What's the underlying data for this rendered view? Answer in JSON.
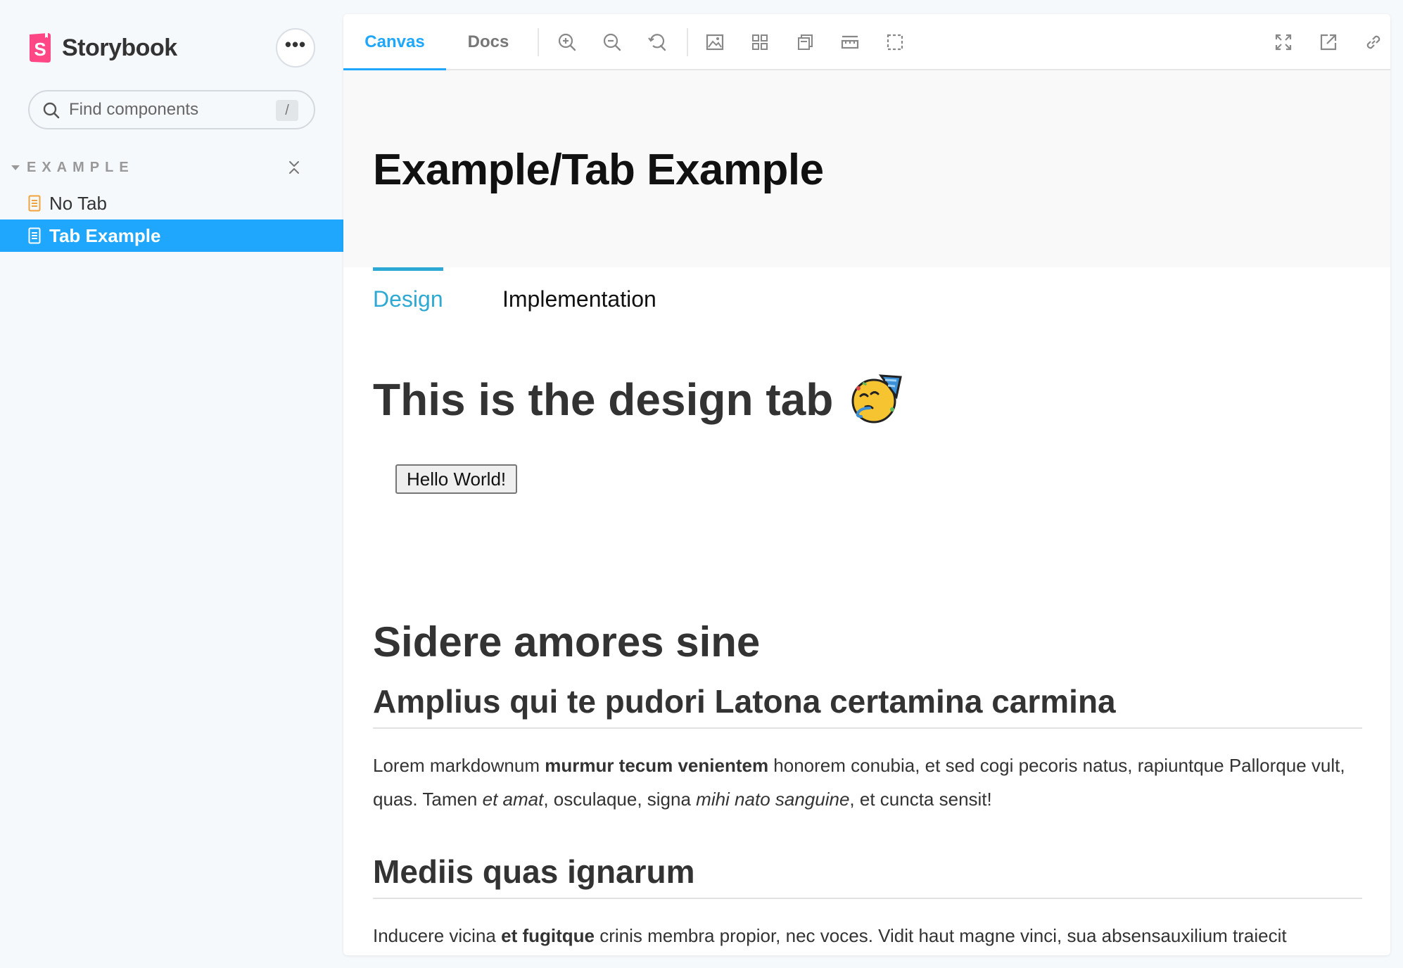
{
  "sidebar": {
    "brand": "Storybook",
    "search_placeholder": "Find components",
    "search_shortcut": "/",
    "section_title": "EXAMPLE",
    "items": [
      {
        "label": "No Tab",
        "selected": false
      },
      {
        "label": "Tab Example",
        "selected": true
      }
    ]
  },
  "toolbar": {
    "tabs": [
      {
        "label": "Canvas",
        "active": true
      },
      {
        "label": "Docs",
        "active": false
      }
    ],
    "tools": [
      "zoom-in-icon",
      "zoom-out-icon",
      "reset-zoom-icon",
      "background-icon",
      "grid-icon",
      "measure-icon",
      "ruler-icon",
      "outline-icon"
    ],
    "right_tools": [
      "fullscreen-icon",
      "open-new-tab-icon",
      "copy-link-icon"
    ]
  },
  "colors": {
    "accent": "#1ea7fd",
    "subtab_accent": "#2ea9d3",
    "brand_pink": "#ff4785"
  },
  "content": {
    "page_title": "Example/Tab Example",
    "subtabs": [
      {
        "label": "Design",
        "active": true
      },
      {
        "label": "Implementation",
        "active": false
      }
    ],
    "design_heading": "This is the design tab",
    "emoji": "partying-face",
    "button_label": "Hello World!",
    "h1": "Sidere amores sine",
    "h2_a": "Amplius qui te pudori Latona certamina carmina",
    "p1": {
      "t1": "Lorem markdownum ",
      "b1": "murmur tecum venientem",
      "t2": " honorem conubia, et sed cogi pecoris natus, rapiuntque Pallorque vult, quas. Tamen ",
      "i1": "et amat",
      "t3": ", osculaque, signa ",
      "i2": "mihi nato sanguine",
      "t4": ", et cuncta sensit!"
    },
    "h2_b": "Mediis quas ignarum",
    "p2": {
      "t1": "Inducere vicina ",
      "b1": "et fugitque",
      "t2": " crinis membra propior, nec voces. Vidit haut magne vinci, sua absensauxilium traiecit"
    }
  }
}
